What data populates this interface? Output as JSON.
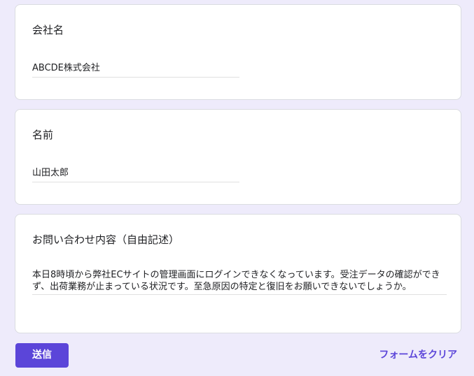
{
  "form": {
    "questions": [
      {
        "title": "会社名",
        "answer": "ABCDE株式会社"
      },
      {
        "title": "名前",
        "answer": "山田太郎"
      },
      {
        "title": "お問い合わせ内容（自由記述）",
        "answer": "本日8時頃から弊社ECサイトの管理画面にログインできなくなっています。受注データの確認ができず、出荷業務が止まっている状況です。至急原因の特定と復旧をお願いできないでしょうか。"
      }
    ],
    "submit_label": "送信",
    "clear_label": "フォームをクリア"
  },
  "colors": {
    "background": "#EEEBFB",
    "accent": "#5B45D9",
    "card": "#FFFFFF"
  }
}
